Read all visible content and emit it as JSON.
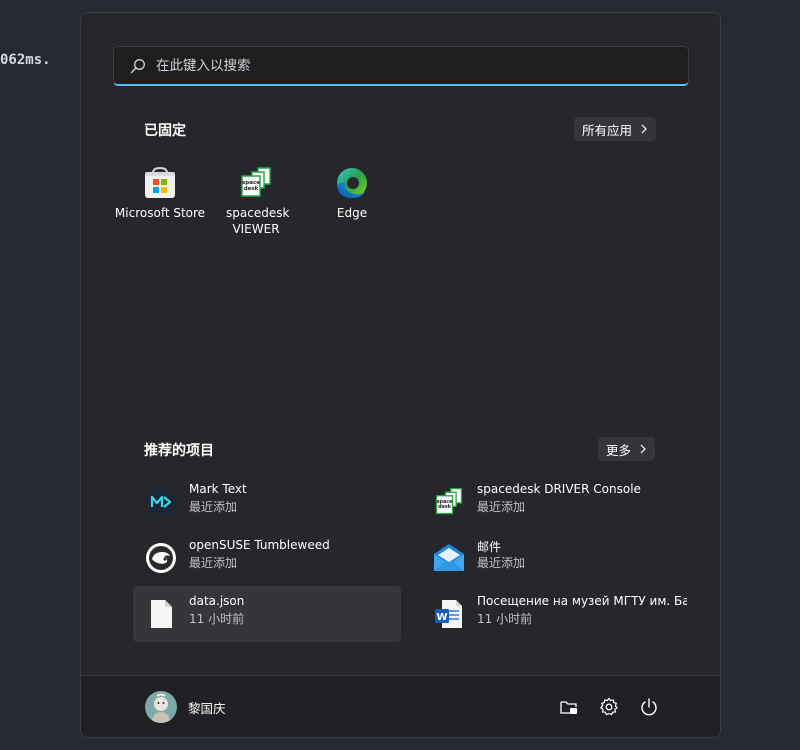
{
  "background": {
    "console_text": "062ms."
  },
  "search": {
    "placeholder": "在此键入以搜索",
    "icon": "search-icon"
  },
  "pinned": {
    "title": "已固定",
    "all_apps_label": "所有应用",
    "apps": [
      {
        "label": "Microsoft Store",
        "icon": "microsoft-store-icon"
      },
      {
        "label": "spacedesk VIEWER",
        "icon": "spacedesk-icon"
      },
      {
        "label": "Edge",
        "icon": "edge-icon"
      }
    ]
  },
  "recommended": {
    "title": "推荐的项目",
    "more_label": "更多",
    "items": [
      {
        "title": "Mark Text",
        "subtitle": "最近添加",
        "icon": "marktext-icon"
      },
      {
        "title": "spacedesk DRIVER Console",
        "subtitle": "最近添加",
        "icon": "spacedesk-icon"
      },
      {
        "title": "openSUSE Tumbleweed",
        "subtitle": "最近添加",
        "icon": "opensuse-icon"
      },
      {
        "title": "邮件",
        "subtitle": "最近添加",
        "icon": "mail-icon"
      },
      {
        "title": "data.json",
        "subtitle": "11 小时前",
        "icon": "file-icon"
      },
      {
        "title": "Посещение на музей МГТУ им. Ба...",
        "subtitle": "11 小时前",
        "icon": "word-doc-icon"
      }
    ]
  },
  "user": {
    "name": "黎国庆",
    "avatar": "avatar"
  },
  "footer_buttons": [
    "file-explorer-icon",
    "settings-icon",
    "power-icon"
  ],
  "colors": {
    "accent": "#4cc2ff",
    "menu_bg": "#25272b",
    "footer_bg": "#1f2023"
  }
}
